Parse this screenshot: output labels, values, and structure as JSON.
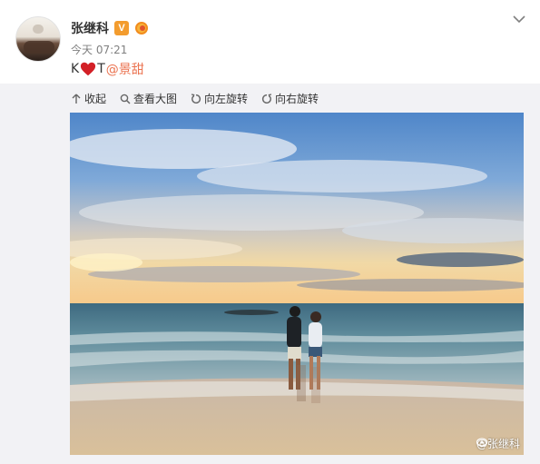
{
  "post": {
    "username": "张继科",
    "verified_badge": "V",
    "time": "今天 07:21",
    "content_prefix": "K",
    "content_suffix": "T",
    "mention": "@景甜"
  },
  "toolbar": {
    "collapse_label": "收起",
    "view_large_label": "查看大图",
    "rotate_left_label": "向左旋转",
    "rotate_right_label": "向右旋转"
  },
  "photo": {
    "watermark": "@张继科"
  },
  "colors": {
    "mention": "#eb7350",
    "badge": "#f39c2e",
    "toolbar_bg": "#f2f2f5"
  }
}
